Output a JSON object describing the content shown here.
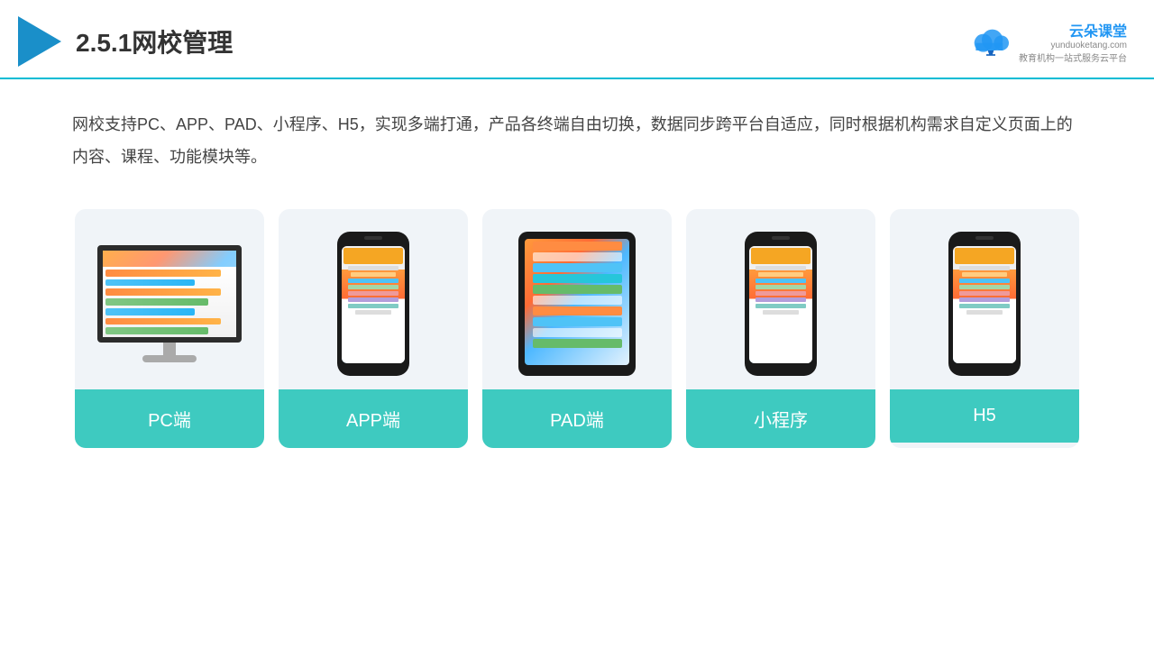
{
  "header": {
    "title": "2.5.1网校管理",
    "brand_name": "云朵课堂",
    "brand_url": "yunduoketang.com",
    "brand_slogan": "教育机构一站式服务云平台"
  },
  "description": "网校支持PC、APP、PAD、小程序、H5，实现多端打通，产品各终端自由切换，数据同步跨平台自适应，同时根据机构需求自定义页面上的内容、课程、功能模块等。",
  "cards": [
    {
      "id": "pc",
      "label": "PC端"
    },
    {
      "id": "app",
      "label": "APP端"
    },
    {
      "id": "pad",
      "label": "PAD端"
    },
    {
      "id": "miniprogram",
      "label": "小程序"
    },
    {
      "id": "h5",
      "label": "H5"
    }
  ]
}
